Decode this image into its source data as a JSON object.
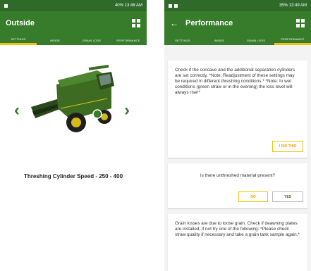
{
  "left_screen": {
    "status_bar": {
      "time": "13:46 AM",
      "battery": "40%"
    },
    "title": "Outside",
    "tabs": [
      "SETTINGS",
      "INSIDE",
      "GRAIN LOSS",
      "PERFORMANCE"
    ],
    "active_tab": 0,
    "caption": "Threshing Cylinder Speed - 250 - 400"
  },
  "right_screen": {
    "status_bar": {
      "time": "13:49 AM",
      "battery": "35%"
    },
    "title": "Performance",
    "tabs": [
      "SETTINGS",
      "INSIDE",
      "GRAIN LOSS",
      "PERFORMANCE"
    ],
    "active_tab": 3,
    "card1_text": "Check if the concave and the additional separation cylinders are set correctly. *Note: Readjustment of these settings may be required in different threshing conditions.* *Note: In wet conditions (green straw or in the evening) the loss level will always rise!*",
    "card1_button": "I DID THIS",
    "question": "Is there unthreshed material present?",
    "no_label": "NO",
    "yes_label": "YES",
    "card3_text": "Grain losses are due to loose grain. Check if deawning plates are installed; if not try one of the following: *Please check straw quality if necessary and take a grain tank sample again.*"
  },
  "colors": {
    "green": "#367c2b",
    "dark_green": "#2f6a2b",
    "yellow": "#f4c20d"
  }
}
